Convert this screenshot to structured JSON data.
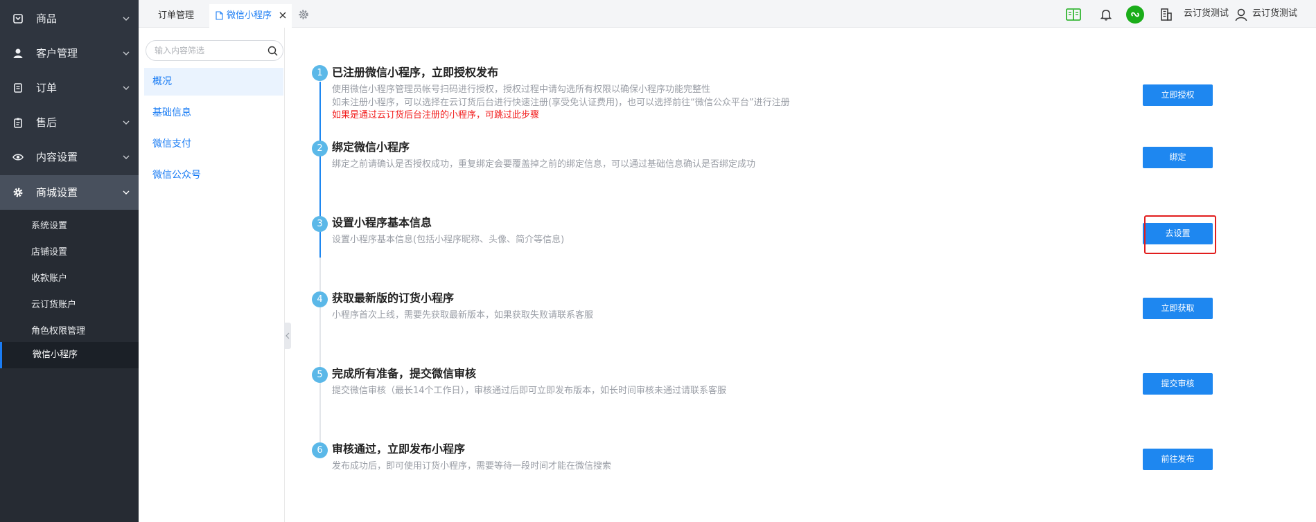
{
  "sidebar": {
    "menu": [
      {
        "label": "商品",
        "icon": "box-icon"
      },
      {
        "label": "客户管理",
        "icon": "user-icon"
      },
      {
        "label": "订单",
        "icon": "order-icon"
      },
      {
        "label": "售后",
        "icon": "clipboard-icon"
      },
      {
        "label": "内容设置",
        "icon": "eye-icon"
      },
      {
        "label": "商城设置",
        "icon": "gear-icon"
      }
    ],
    "submenu": [
      {
        "label": "系统设置"
      },
      {
        "label": "店铺设置"
      },
      {
        "label": "收款账户"
      },
      {
        "label": "云订货账户"
      },
      {
        "label": "角色权限管理"
      },
      {
        "label": "微信小程序"
      }
    ]
  },
  "topbar": {
    "tabs": [
      {
        "label": "订单管理"
      },
      {
        "label": "微信小程序"
      }
    ],
    "right": {
      "store_name": "云订货测试",
      "user_name": "云订货测试"
    }
  },
  "subpanel": {
    "search_placeholder": "输入内容筛选",
    "items": [
      {
        "label": "概况"
      },
      {
        "label": "基础信息"
      },
      {
        "label": "微信支付"
      },
      {
        "label": "微信公众号"
      }
    ]
  },
  "steps": [
    {
      "number": "1",
      "title": "已注册微信小程序，立即授权发布",
      "desc": [
        "使用微信小程序管理员帐号扫码进行授权，授权过程中请勾选所有权限以确保小程序功能完整性",
        "如未注册小程序，可以选择在云订货后台进行快速注册(享受免认证费用)，也可以选择前往“微信公众平台”进行注册"
      ],
      "note": "如果是通过云订货后台注册的小程序，可跳过此步骤",
      "button": "立即授权"
    },
    {
      "number": "2",
      "title": "绑定微信小程序",
      "desc": [
        "绑定之前请确认是否授权成功，重复绑定会要覆盖掉之前的绑定信息，可以通过基础信息确认是否绑定成功"
      ],
      "button": "绑定"
    },
    {
      "number": "3",
      "title": "设置小程序基本信息",
      "desc": [
        "设置小程序基本信息(包括小程序昵称、头像、简介等信息)"
      ],
      "button": "去设置"
    },
    {
      "number": "4",
      "title": "获取最新版的订货小程序",
      "desc": [
        "小程序首次上线，需要先获取最新版本，如果获取失败请联系客服"
      ],
      "button": "立即获取"
    },
    {
      "number": "5",
      "title": "完成所有准备，提交微信审核",
      "desc": [
        "提交微信审核（最长14个工作日），审核通过后即可立即发布版本，如长时间审核未通过请联系客服"
      ],
      "button": "提交审核"
    },
    {
      "number": "6",
      "title": "审核通过，立即发布小程序",
      "desc": [
        "发布成功后，即可使用订货小程序，需要等待一段时间才能在微信搜索"
      ],
      "button": "前往发布"
    }
  ],
  "colors": {
    "sidebar_bg": "#2f353f",
    "accent": "#1e87f0",
    "step_badge": "#5bb8e8",
    "warning_red": "#f21d1d",
    "wechat_green": "#1aad19"
  }
}
